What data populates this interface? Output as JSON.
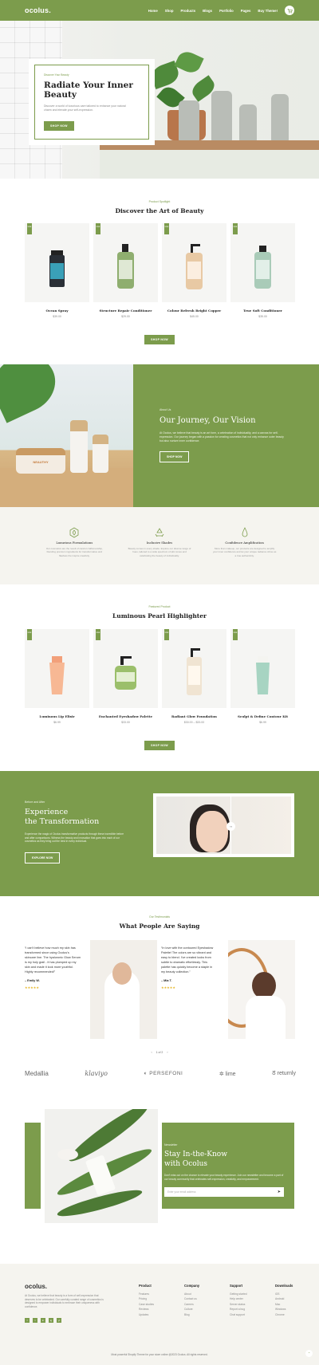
{
  "header": {
    "logo": "ocolus.",
    "nav": [
      "Home",
      "Shop",
      "Products",
      "Blogs",
      "Portfolio",
      "Pages",
      "Buy Theme!"
    ],
    "cart_icon": "cart-icon"
  },
  "hero": {
    "eyebrow": "Discover Your Beauty",
    "title": "Radiate Your Inner Beauty",
    "text": "Discover a world of luxurious care tailored to enhance your natural charm and elevate your self-expression.",
    "button": "SHOP NOW"
  },
  "featured": {
    "eyebrow": "Product Spotlight",
    "title": "Discover the Art of Beauty",
    "products": [
      {
        "tag": "Hot",
        "name": "Ocean Spray",
        "price": "$39.00"
      },
      {
        "tag": "Hot",
        "name": "Structure Repair Conditioner",
        "price": "$29.00"
      },
      {
        "tag": "Hot",
        "name": "Colour Refresh Bright Copper",
        "price": "$45.00"
      },
      {
        "tag": "Hot",
        "name": "True Soft Conditioner",
        "price": "$35.00"
      }
    ],
    "button": "SHOP NOW"
  },
  "journey": {
    "eyebrow": "About Us",
    "title": "Our Journey, Our Vision",
    "text": "At Ocolus, we believe that beauty is an art form, a celebration of individuality, and a canvas for self-expression. Our journey began with a passion for creating cosmetics that not only enhance outer beauty but also nurture inner confidence.",
    "button": "SHOP NOW",
    "jar_label": "NEAUTHY"
  },
  "features": [
    {
      "icon": "leaf-badge-icon",
      "title": "Luxurious Formulations",
      "desc": "Our cosmetics are the result of careful craftsmanship, blending premium ingredients for transformative and flawless the inspire creativity."
    },
    {
      "icon": "recycle-icon",
      "title": "Inclusive Shades",
      "desc": "Beauty comes in every shade. Explore our diverse range of hues, tailored to a wide spectrum of skin tones and celebrating the beauty of individuality."
    },
    {
      "icon": "drop-icon",
      "title": "Confidence Amplification",
      "desc": "More than makeup, our products are designed to amplify your inner confidence and let your unique radiance shine as a true authenticity."
    }
  ],
  "highlight": {
    "eyebrow": "Featured Product",
    "title": "Luminous Pearl Highlighter",
    "products": [
      {
        "tag": "Hot",
        "name": "Luminous Lip Elixir",
        "price": "$6.99"
      },
      {
        "tag": "Hot",
        "name": "Enchanted Eyeshadow Palette",
        "price": "$33.00"
      },
      {
        "tag": "Hot",
        "name": "Radiant Glow Foundation",
        "price": "$30.00 – $33.00"
      },
      {
        "tag": "Hot",
        "name": "Sculpt & Define Contour Kit",
        "price": "$6.99"
      }
    ],
    "button": "SHOP NOW"
  },
  "transform": {
    "eyebrow": "Before and After",
    "title_line1": "Experience",
    "title_line2": "the Transformation",
    "text": "Experience the magic of Ocolus transformative products through these incredible before and after comparisons. Witness the beauty and innovation that goes into each of our cosmetics as they bring out the best in every individual.",
    "button": "EXPLORE NOW",
    "compare_icon": "drag-compare-icon"
  },
  "testimonials": {
    "eyebrow": "Our Testimonials",
    "title": "What People Are Saying",
    "items": [
      {
        "quote": "“I can't believe how much my skin has transformed since using Ocolus's skincare line. The hyaluronic Glow Serum is my holy grail - it has plumped up my skin and made it look more youthful. Highly recommended!”",
        "name": "– Emily W.",
        "stars": "★★★★★"
      },
      {
        "quote": "“In love with the contoured Eyeshadow Palette! The colors are so vibrant and easy to blend. I've created looks from subtle to dramatic effortlessly. This palette has quickly become a staple in my beauty collection.”",
        "name": "– Mia T.",
        "stars": "★★★★★"
      }
    ],
    "pager": "1 of 2"
  },
  "brands": [
    "Medallia",
    "klaviyo",
    "PERSEFONI",
    "lime",
    "returnly"
  ],
  "newsletter": {
    "eyebrow": "Newsletter",
    "title_line1": "Stay In-the-Know",
    "title_line2": "with Ocolus",
    "text": "Don't miss out on the chance to elevate your beauty experience. Join our newsletter and become a part of our beauty community that celebrates self-expression, creativity, and empowerment.",
    "placeholder": "Enter your email address"
  },
  "footer": {
    "logo": "ocolus.",
    "about": "At Ocolus, we believe that beauty is a form of self-expression that deserves to be celebrated. Our carefully curated range of cosmetics is designed to empower individuals to embrace their uniqueness with confidence.",
    "columns": [
      {
        "heading": "Product",
        "items": [
          "Features",
          "Pricing",
          "Case studies",
          "Reviews",
          "Updates"
        ]
      },
      {
        "heading": "Company",
        "items": [
          "About",
          "Contact us",
          "Careers",
          "Culture",
          "Blog"
        ]
      },
      {
        "heading": "Support",
        "items": [
          "Getting started",
          "Help center",
          "Server status",
          "Report a bug",
          "Chat support"
        ]
      },
      {
        "heading": "Downloads",
        "items": [
          "iOS",
          "Android",
          "Mac",
          "Windows",
          "Chrome"
        ]
      }
    ],
    "social": [
      "f",
      "t",
      "in",
      "ig",
      "yt"
    ],
    "copyright": "Most powerful Shopify Theme for your store online @2023 Ocolus. All rights reserved."
  },
  "colors": {
    "accent": "#7c9c4c",
    "light_bg": "#f5f4ef"
  }
}
